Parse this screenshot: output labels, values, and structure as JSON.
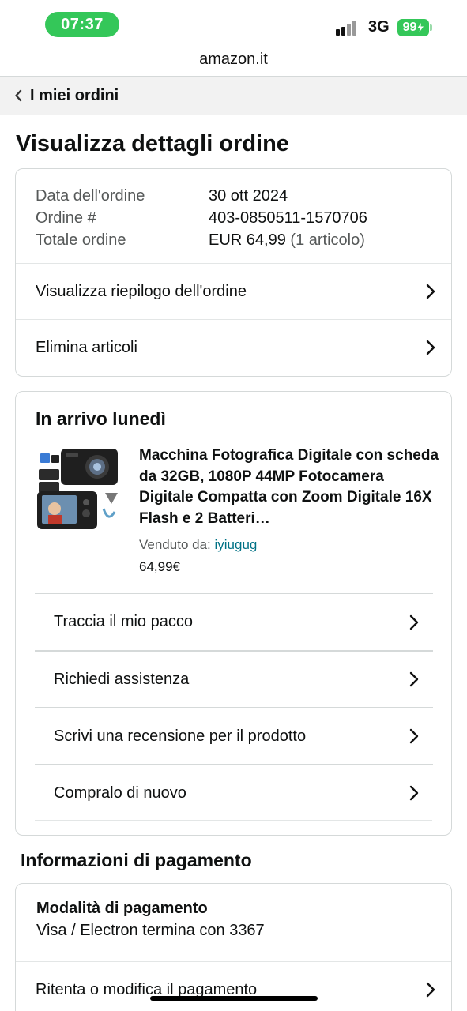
{
  "status_bar": {
    "time": "07:37",
    "network": "3G",
    "battery": "99"
  },
  "browser": {
    "url": "amazon.it"
  },
  "back_nav": {
    "label": "I miei ordini"
  },
  "page_title": "Visualizza dettagli ordine",
  "order_summary": {
    "date_label": "Data dell'ordine",
    "date_value": "30 ott 2024",
    "order_label": "Ordine #",
    "order_value": "403-0850511-1570706",
    "total_label": "Totale ordine",
    "total_value": "EUR 64,99",
    "total_items": "(1 articolo)",
    "actions": [
      {
        "label": "Visualizza riepilogo dell'ordine"
      },
      {
        "label": "Elimina articoli"
      }
    ]
  },
  "shipment": {
    "heading": "In arrivo lunedì",
    "product": {
      "image_icon": "camera-product-image",
      "title": "Macchina Fotografica Digitale con scheda da 32GB, 1080P 44MP Fotocamera Digitale Compatta con Zoom Digitale 16X Flash e 2 Batteri…",
      "sold_by_label": "Venduto da:",
      "seller": "iyiugug",
      "price": "64,99€"
    },
    "actions": [
      {
        "label": "Traccia il mio pacco"
      },
      {
        "label": "Richiedi assistenza"
      },
      {
        "label": "Scrivi una recensione per il prodotto"
      },
      {
        "label": "Compralo di nuovo"
      }
    ]
  },
  "payment": {
    "heading": "Informazioni di pagamento",
    "method_label": "Modalità di pagamento",
    "method_value": "Visa / Electron  termina con 3367",
    "retry_label": "Ritenta o modifica il pagamento"
  },
  "colors": {
    "status_green": "#34c759",
    "link": "#007185",
    "border": "#d5d9d9",
    "text": "#0f1111",
    "muted": "#565959"
  }
}
